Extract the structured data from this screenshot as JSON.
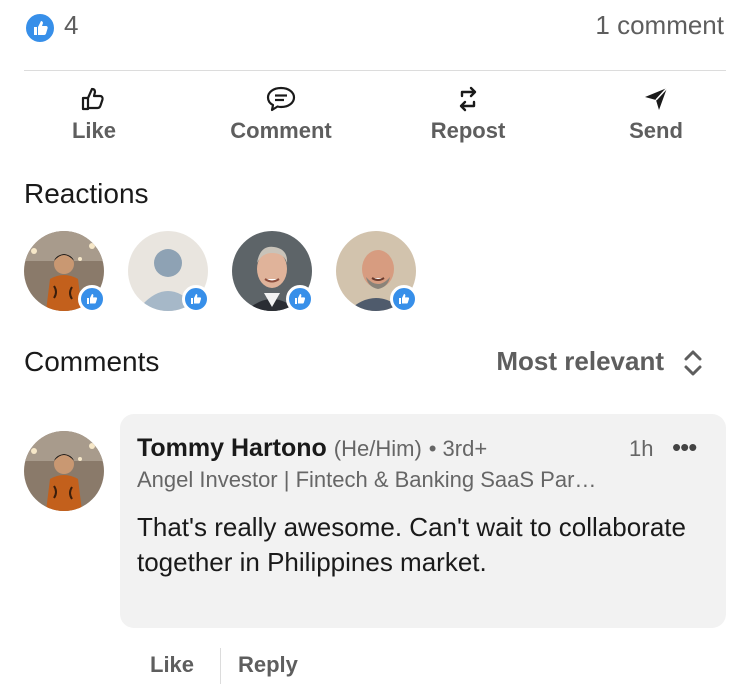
{
  "summary": {
    "like_count": "4",
    "comment_count": "1 comment"
  },
  "actions": {
    "like": "Like",
    "comment": "Comment",
    "repost": "Repost",
    "send": "Send"
  },
  "reactions": {
    "title": "Reactions",
    "people": [
      {
        "avatar": "person-in-batik-shirt-photo",
        "reaction": "like"
      },
      {
        "avatar": "default-profile-placeholder",
        "reaction": "like"
      },
      {
        "avatar": "smiling-gray-haired-man-photo",
        "reaction": "like"
      },
      {
        "avatar": "smiling-bald-man-photo",
        "reaction": "like"
      }
    ]
  },
  "comments": {
    "title": "Comments",
    "sort_label": "Most relevant",
    "items": [
      {
        "author": "Tommy Hartono",
        "pronouns": "(He/Him)",
        "degree": "• 3rd+",
        "time": "1h",
        "more": "•••",
        "headline": "Angel Investor | Fintech & Banking SaaS Par…",
        "text": "That's really awesome. Can't wait to collaborate together in Philippines market.",
        "like_label": "Like",
        "reply_label": "Reply"
      }
    ]
  },
  "colors": {
    "accent": "#378fe9",
    "text_muted": "#5e5e5e",
    "bubble_bg": "#f2f2f2"
  }
}
